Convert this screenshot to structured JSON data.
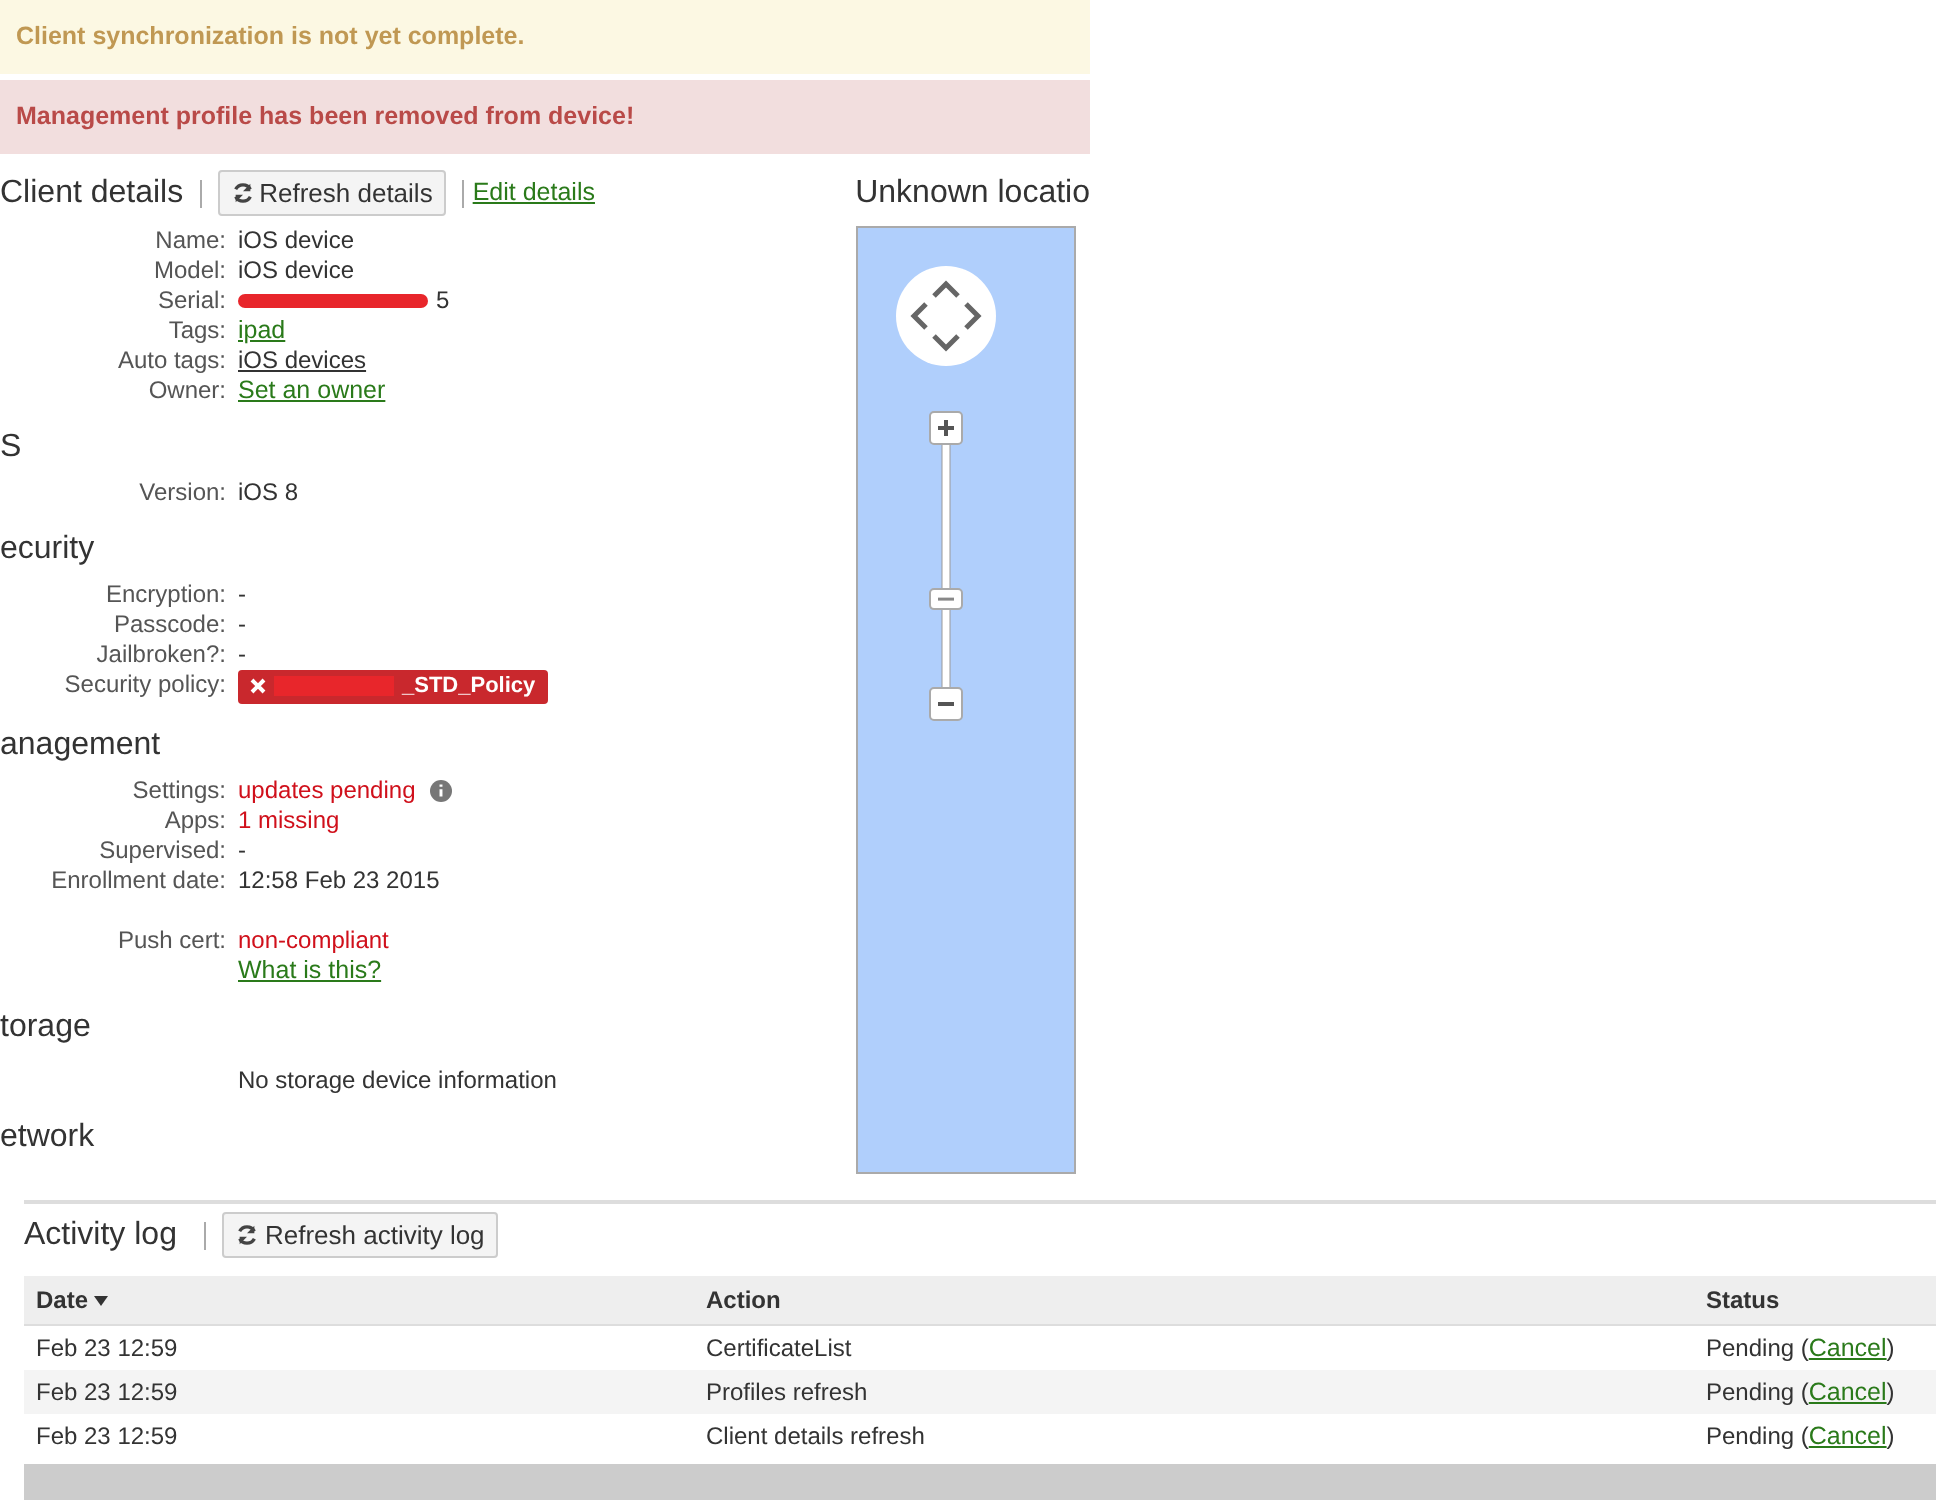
{
  "alerts": [
    {
      "kind": "warning",
      "text": "Client synchronization is not yet complete."
    },
    {
      "kind": "danger",
      "text": "Management profile has been removed from device!"
    }
  ],
  "client_details": {
    "title": "Client details",
    "refresh_button": "Refresh details",
    "edit_link": "Edit details"
  },
  "sections": [
    {
      "fields": [
        {
          "label": "Name:",
          "values": [
            {
              "kind": "text",
              "text": "iOS device"
            }
          ]
        },
        {
          "label": "Model:",
          "values": [
            {
              "kind": "text",
              "text": "iOS device"
            }
          ]
        },
        {
          "label": "Serial:",
          "values": [
            {
              "kind": "redacted",
              "text": "5"
            }
          ]
        },
        {
          "label": "Tags:",
          "values": [
            {
              "kind": "link",
              "text": "ipad"
            }
          ]
        },
        {
          "label": "Auto tags:",
          "values": [
            {
              "kind": "plainlink",
              "text": "iOS devices"
            }
          ]
        },
        {
          "label": "Owner:",
          "values": [
            {
              "kind": "link",
              "text": "Set an owner"
            }
          ]
        }
      ]
    },
    {
      "title": "S",
      "fields": [
        {
          "label": "Version:",
          "values": [
            {
              "kind": "text",
              "text": "iOS 8"
            }
          ]
        }
      ]
    },
    {
      "title": "ecurity",
      "fields": [
        {
          "label": "Encryption:",
          "values": [
            {
              "kind": "text",
              "text": "-"
            }
          ]
        },
        {
          "label": "Passcode:",
          "values": [
            {
              "kind": "text",
              "text": "-"
            }
          ]
        },
        {
          "label": "Jailbroken?:",
          "values": [
            {
              "kind": "text",
              "text": "-"
            }
          ]
        },
        {
          "label": "Security policy:",
          "values": [
            {
              "kind": "badge",
              "text": "_STD_Policy"
            }
          ]
        }
      ]
    },
    {
      "title": "anagement",
      "fields": [
        {
          "label": "Settings:",
          "values": [
            {
              "kind": "warn_info",
              "text": "updates pending"
            }
          ]
        },
        {
          "label": "Apps:",
          "values": [
            {
              "kind": "warn",
              "text": "1 missing"
            }
          ]
        },
        {
          "label": "Supervised:",
          "values": [
            {
              "kind": "text",
              "text": "-"
            }
          ]
        },
        {
          "label": "Enrollment date:",
          "values": [
            {
              "kind": "text",
              "text": "12:58 Feb 23 2015"
            }
          ]
        },
        {
          "label": "Push cert:",
          "gap": true,
          "values": [
            {
              "kind": "warn",
              "text": "non-compliant"
            },
            {
              "kind": "link",
              "text": "What is this?"
            }
          ]
        }
      ]
    },
    {
      "title": "torage",
      "fields": [
        {
          "values": [
            {
              "kind": "text",
              "text": "No storage device information"
            }
          ]
        }
      ]
    },
    {
      "title": "etwork"
    }
  ],
  "map": {
    "title": "Unknown locatio",
    "level": 0.38
  },
  "activity_log": {
    "title": "Activity log",
    "refresh_button": "Refresh activity log",
    "columns": [
      {
        "label": "Date",
        "sorted": true
      },
      {
        "label": "Action",
        "sorted": false
      },
      {
        "label": "Status",
        "sorted": false
      }
    ],
    "rows": [
      {
        "date": "Feb 23 12:59",
        "action": "CertificateList",
        "status": "Pending (",
        "cancel": "Cancel",
        "status_end": ")"
      },
      {
        "date": "Feb 23 12:59",
        "action": "Profiles refresh",
        "status": "Pending (",
        "cancel": "Cancel",
        "status_end": ")"
      },
      {
        "date": "Feb 23 12:59",
        "action": "Client details refresh",
        "status": "Pending (",
        "cancel": "Cancel",
        "status_end": ")"
      }
    ]
  }
}
